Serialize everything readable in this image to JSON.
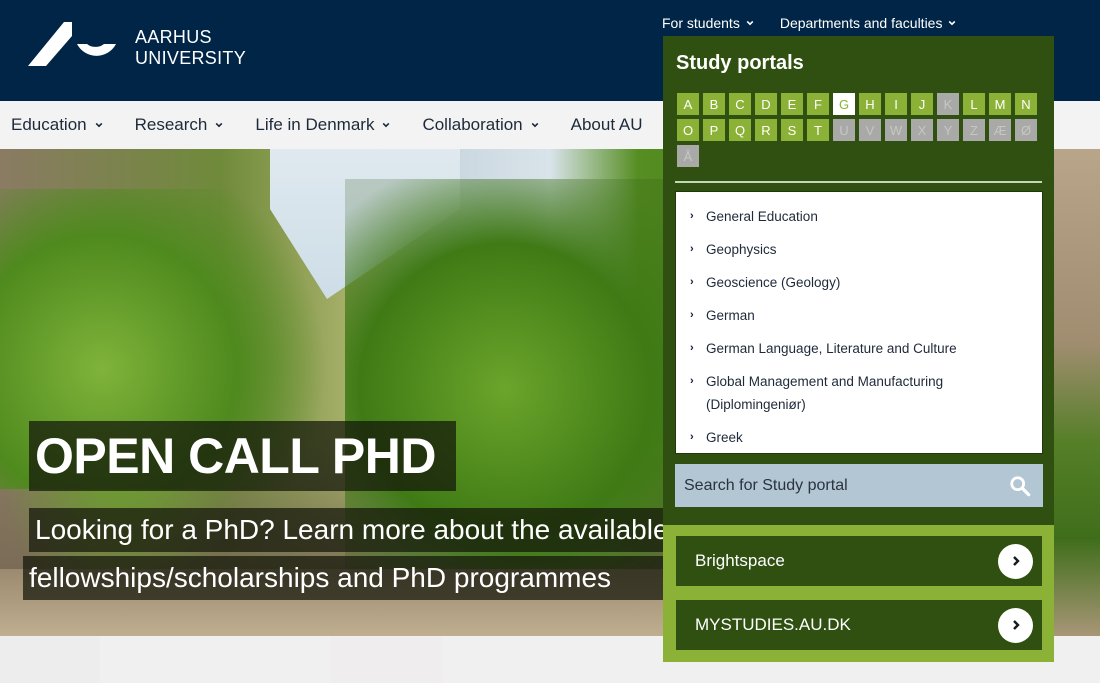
{
  "header": {
    "logo_line1": "AARHUS",
    "logo_line2": "UNIVERSITY",
    "utility_nav": [
      {
        "label": "For students",
        "icon": "chevron-down-icon"
      },
      {
        "label": "Departments and faculties",
        "icon": "chevron-down-icon"
      }
    ]
  },
  "main_nav": [
    {
      "label": "Education"
    },
    {
      "label": "Research"
    },
    {
      "label": "Life in Denmark"
    },
    {
      "label": "Collaboration"
    },
    {
      "label": "About AU"
    }
  ],
  "hero": {
    "title": "OPEN CALL PHD",
    "subtitle_line1": "Looking for a PhD? Learn more about the available",
    "subtitle_line2": "fellowships/scholarships and PhD programmes"
  },
  "study_portals": {
    "title": "Study portals",
    "letters": [
      {
        "letter": "A",
        "state": "enabled"
      },
      {
        "letter": "B",
        "state": "enabled"
      },
      {
        "letter": "C",
        "state": "enabled"
      },
      {
        "letter": "D",
        "state": "enabled"
      },
      {
        "letter": "E",
        "state": "enabled"
      },
      {
        "letter": "F",
        "state": "enabled"
      },
      {
        "letter": "G",
        "state": "active"
      },
      {
        "letter": "H",
        "state": "enabled"
      },
      {
        "letter": "I",
        "state": "enabled"
      },
      {
        "letter": "J",
        "state": "enabled"
      },
      {
        "letter": "K",
        "state": "disabled"
      },
      {
        "letter": "L",
        "state": "enabled"
      },
      {
        "letter": "M",
        "state": "enabled"
      },
      {
        "letter": "N",
        "state": "enabled"
      },
      {
        "letter": "O",
        "state": "enabled"
      },
      {
        "letter": "P",
        "state": "enabled"
      },
      {
        "letter": "Q",
        "state": "enabled"
      },
      {
        "letter": "R",
        "state": "enabled"
      },
      {
        "letter": "S",
        "state": "enabled"
      },
      {
        "letter": "T",
        "state": "enabled"
      },
      {
        "letter": "U",
        "state": "disabled"
      },
      {
        "letter": "V",
        "state": "disabled"
      },
      {
        "letter": "W",
        "state": "disabled"
      },
      {
        "letter": "X",
        "state": "disabled"
      },
      {
        "letter": "Y",
        "state": "disabled"
      },
      {
        "letter": "Z",
        "state": "disabled"
      },
      {
        "letter": "Æ",
        "state": "disabled"
      },
      {
        "letter": "Ø",
        "state": "disabled"
      },
      {
        "letter": "Å",
        "state": "disabled"
      }
    ],
    "items": [
      {
        "label": "General Education"
      },
      {
        "label": "Geophysics"
      },
      {
        "label": "Geoscience (Geology)"
      },
      {
        "label": "German"
      },
      {
        "label": "German Language, Literature and Culture"
      },
      {
        "label": "Global Management and Manufacturing (Diplomingeniør)"
      },
      {
        "label": "Greek"
      }
    ],
    "search_placeholder": "Search for Study portal",
    "quick_links": [
      {
        "label": "Brightspace"
      },
      {
        "label": "MYSTUDIES.AU.DK"
      }
    ]
  },
  "colors": {
    "header_navy": "#002546",
    "panel_dark_green": "#2f5010",
    "accent_green": "#8bb237",
    "disabled_gray": "#a9aaa7",
    "search_blue_gray": "#b3c6d3"
  }
}
